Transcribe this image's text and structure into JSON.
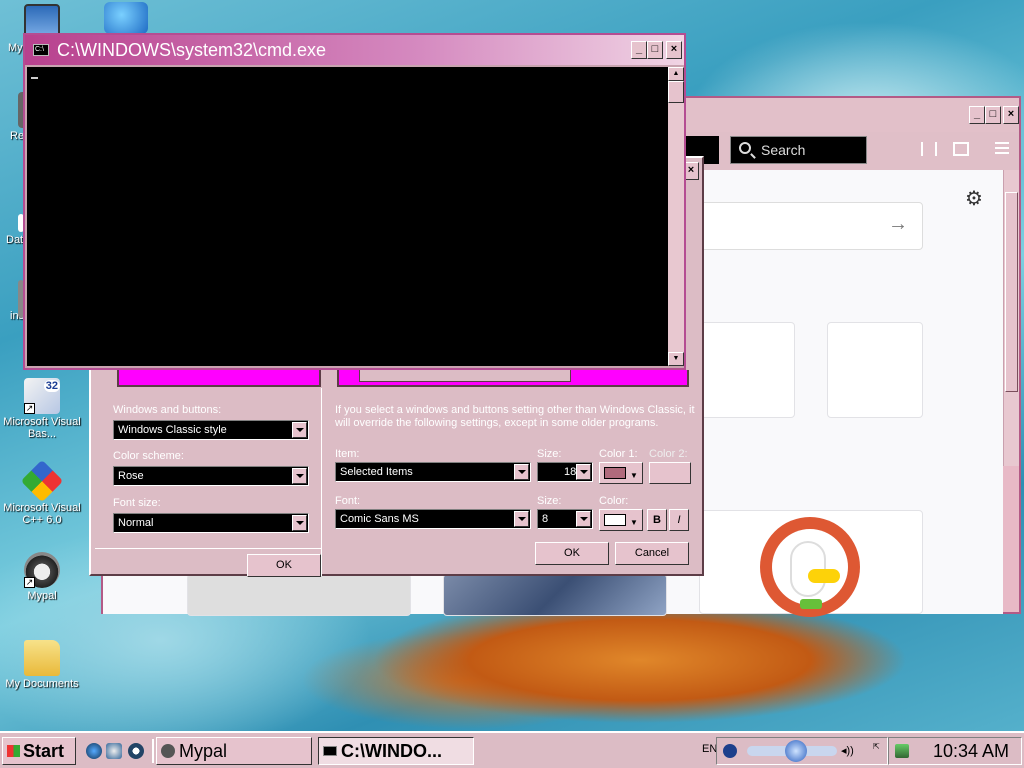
{
  "desktop": {
    "icons": [
      {
        "label": "My"
      },
      {
        "label": "Re"
      },
      {
        "label": "Dat"
      },
      {
        "label": "ins"
      },
      {
        "label": "Microsoft Visual Bas..."
      },
      {
        "label": "Microsoft Visual C++ 6.0"
      },
      {
        "label": "Mypal"
      },
      {
        "label": "My Documents"
      }
    ],
    "badge_32": "32"
  },
  "browser": {
    "search_placeholder": "Search",
    "go_arrow": "→",
    "gear": "⚙",
    "controls": {
      "min": "_",
      "max": "□",
      "close": "×"
    }
  },
  "display_dialog": {
    "windows_and_buttons_label": "Windows and buttons:",
    "windows_and_buttons_value": "Windows Classic style",
    "color_scheme_label": "Color scheme:",
    "color_scheme_value": "Rose",
    "font_size_label": "Font size:",
    "font_size_value": "Normal",
    "ok_left": "OK",
    "info": "If you select a windows and buttons setting other than Windows Classic, it will override the following settings, except in some older programs.",
    "item_label": "Item:",
    "item_value": "Selected Items",
    "size_label": "Size:",
    "size_value": "18",
    "color1_label": "Color 1:",
    "color2_label": "Color 2:",
    "font_label": "Font:",
    "font_value": "Comic Sans MS",
    "font_size_label2": "Size:",
    "font_size_value2": "8",
    "color_label": "Color:",
    "bold": "B",
    "italic": "I",
    "ok": "OK",
    "cancel": "Cancel",
    "close": "×",
    "color1_hex": "#b06a7c",
    "color_hex": "#ffffff"
  },
  "cmd": {
    "title": "C:\\WINDOWS\\system32\\cmd.exe",
    "icon_text": "C:\\",
    "controls": {
      "min": "_",
      "max": "□",
      "close": "×"
    }
  },
  "taskbar": {
    "start": "Start",
    "tasks": [
      {
        "label": "Mypal"
      },
      {
        "label": "C:\\WINDO..."
      }
    ],
    "lang": "EN",
    "clock": "10:34 AM"
  },
  "colors": {
    "accent": "#b44d92",
    "window_face": "#dcbcc5",
    "magenta": "#ff00ff"
  }
}
